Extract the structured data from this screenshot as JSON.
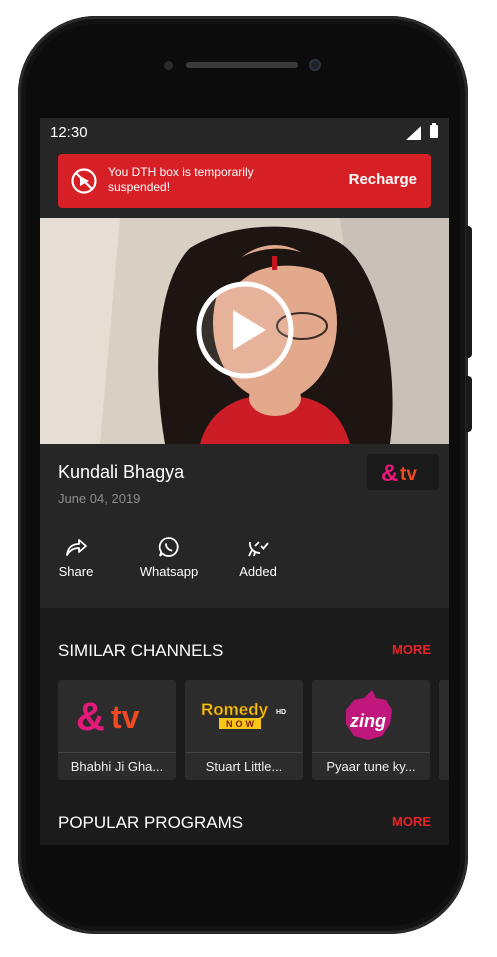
{
  "status_bar": {
    "time": "12:30"
  },
  "alert": {
    "message": "You DTH box is temporarily suspended!",
    "action_label": "Recharge",
    "icon": "blocked-icon",
    "color": "#d71f26"
  },
  "program": {
    "title": "Kundali Bhagya",
    "date": "June 04, 2019",
    "channel_logo": "&tv"
  },
  "actions": [
    {
      "label": "Share",
      "icon": "share-icon"
    },
    {
      "label": "Whatsapp",
      "icon": "whatsapp-icon"
    },
    {
      "label": "Added",
      "icon": "satellite-check-icon"
    }
  ],
  "similar_channels": {
    "title": "SIMILAR CHANNELS",
    "more_label": "MORE",
    "items": [
      {
        "logo": "&tv",
        "label": "Bhabhi Ji Gha..."
      },
      {
        "logo": "Romedy NOW HD",
        "label": "Stuart Little..."
      },
      {
        "logo": "Zing",
        "label": "Pyaar tune ky..."
      }
    ]
  },
  "popular_programs": {
    "title": "POPULAR PROGRAMS",
    "more_label": "MORE"
  },
  "colors": {
    "accent": "#e8232a",
    "andtv_pink": "#e6197a",
    "andtv_orange": "#f04a23"
  }
}
